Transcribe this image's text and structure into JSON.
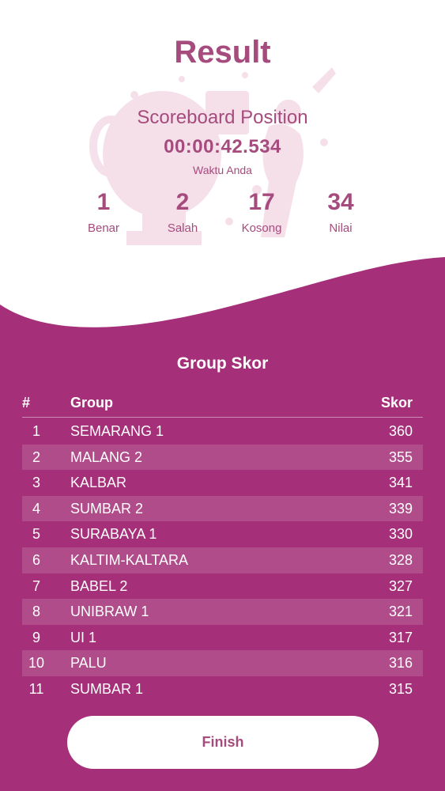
{
  "header": {
    "title": "Result",
    "subtitle": "Scoreboard Position",
    "time": "00:00:42.534",
    "time_label": "Waktu Anda"
  },
  "stats": [
    {
      "value": "1",
      "label": "Benar"
    },
    {
      "value": "2",
      "label": "Salah"
    },
    {
      "value": "17",
      "label": "Kosong"
    },
    {
      "value": "34",
      "label": "Nilai"
    }
  ],
  "group_score": {
    "title": "Group Skor",
    "columns": {
      "num": "#",
      "group": "Group",
      "score": "Skor"
    },
    "rows": [
      {
        "num": "1",
        "group": "SEMARANG 1",
        "score": "360"
      },
      {
        "num": "2",
        "group": "MALANG 2",
        "score": "355"
      },
      {
        "num": "3",
        "group": "KALBAR",
        "score": "341"
      },
      {
        "num": "4",
        "group": "SUMBAR 2",
        "score": "339"
      },
      {
        "num": "5",
        "group": "SURABAYA 1",
        "score": "330"
      },
      {
        "num": "6",
        "group": "KALTIM-KALTARA",
        "score": "328"
      },
      {
        "num": "7",
        "group": "BABEL 2",
        "score": "327"
      },
      {
        "num": "8",
        "group": "UNIBRAW 1",
        "score": "321"
      },
      {
        "num": "9",
        "group": "UI 1",
        "score": "317"
      },
      {
        "num": "10",
        "group": "PALU",
        "score": "316"
      },
      {
        "num": "11",
        "group": "SUMBAR 1",
        "score": "315"
      }
    ]
  },
  "finish_label": "Finish",
  "colors": {
    "accent": "#a64b7d",
    "panel": "#a52f79",
    "text_light": "#ffffff"
  },
  "icons": {
    "decoration": "trophy-celebration-illustration"
  }
}
